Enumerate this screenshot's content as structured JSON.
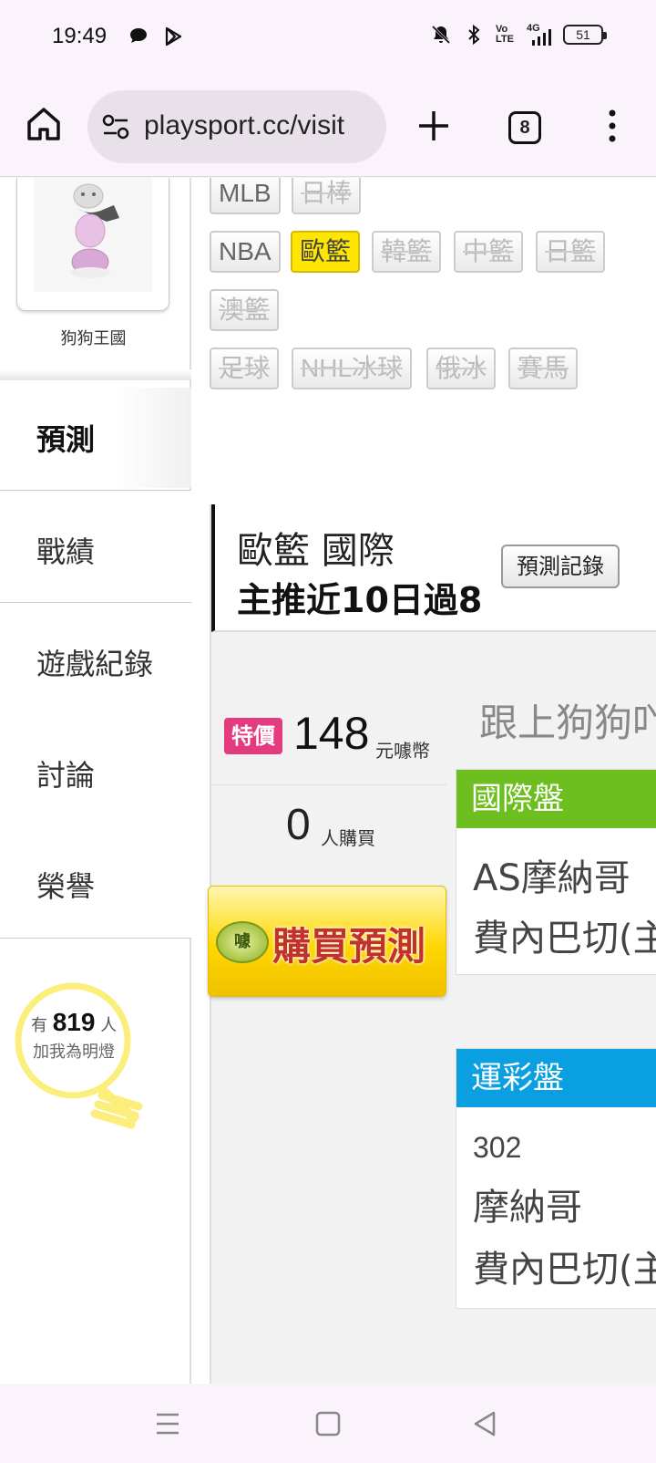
{
  "status_bar": {
    "time": "19:49",
    "battery": "51",
    "network_label": "4G",
    "volte_label": "Vo LTE",
    "icons": [
      "chat-icon",
      "play-store-icon",
      "mute-icon",
      "bluetooth-icon",
      "volte-icon",
      "signal-icon",
      "battery-icon"
    ]
  },
  "browser": {
    "url": "playsport.cc/visit",
    "tab_count": "8",
    "icons": [
      "home-icon",
      "site-settings-icon",
      "new-tab-icon",
      "tab-switcher-icon",
      "more-menu-icon"
    ]
  },
  "sidebar": {
    "user_name": "狗狗王國",
    "section_title": "預測",
    "items": [
      "戰績",
      "遊戲紀錄",
      "討論",
      "榮譽"
    ],
    "fans_prefix": "有",
    "fans_count": "819",
    "fans_unit": "人",
    "fans_suffix": "加我為明燈"
  },
  "sport_tags": {
    "row1": [
      "MLB",
      "日棒"
    ],
    "row2": [
      "NBA",
      "歐籃",
      "韓籃",
      "中籃",
      "日籃"
    ],
    "row3": [
      "澳籃"
    ],
    "row4": [
      "足球",
      "NHL冰球",
      "俄冰",
      "賽馬"
    ],
    "selected": "歐籃"
  },
  "main": {
    "league": "歐籃 國際",
    "headline": "主推近10日過8",
    "record_button": "預測記錄",
    "special_badge": "特價",
    "price": "148",
    "currency": "元噱幣",
    "buyers_count": "0",
    "buyers_label": "人購買",
    "buy_button": "購買預測",
    "buy_coin_label": "噱",
    "follow_text": "跟上狗狗吖",
    "intl_odds": {
      "title": "國際盤",
      "lines": [
        "AS摩納哥",
        "費內巴切(主"
      ]
    },
    "lottery_odds": {
      "title": "運彩盤",
      "number": "302",
      "lines": [
        "摩納哥",
        "費內巴切(主"
      ]
    }
  },
  "colors": {
    "selected_tag": "#ffe600",
    "intl_header": "#6cbf1e",
    "lottery_header": "#0a9fe0",
    "special_badge": "#e43a7e",
    "buy_text": "#c0322a"
  },
  "nav": {
    "icons": [
      "recent-apps-icon",
      "home-nav-icon",
      "back-icon"
    ]
  }
}
